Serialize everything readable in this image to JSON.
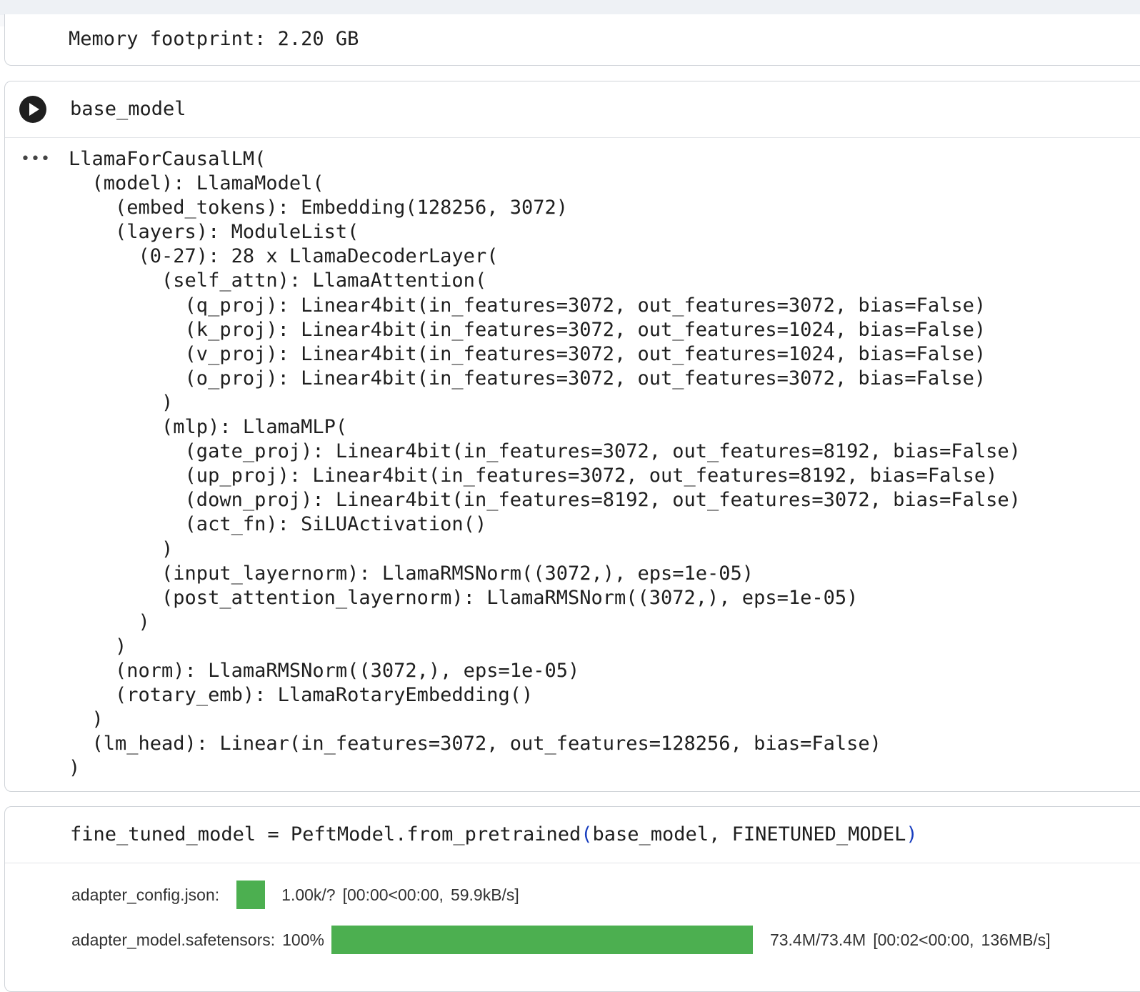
{
  "prev_cell": {
    "output_text": "Memory footprint: 2.20 GB"
  },
  "cell_model": {
    "code": "base_model",
    "output_menu": "•••",
    "output_lines": [
      "LlamaForCausalLM(",
      "  (model): LlamaModel(",
      "    (embed_tokens): Embedding(128256, 3072)",
      "    (layers): ModuleList(",
      "      (0-27): 28 x LlamaDecoderLayer(",
      "        (self_attn): LlamaAttention(",
      "          (q_proj): Linear4bit(in_features=3072, out_features=3072, bias=False)",
      "          (k_proj): Linear4bit(in_features=3072, out_features=1024, bias=False)",
      "          (v_proj): Linear4bit(in_features=3072, out_features=1024, bias=False)",
      "          (o_proj): Linear4bit(in_features=3072, out_features=3072, bias=False)",
      "        )",
      "        (mlp): LlamaMLP(",
      "          (gate_proj): Linear4bit(in_features=3072, out_features=8192, bias=False)",
      "          (up_proj): Linear4bit(in_features=3072, out_features=8192, bias=False)",
      "          (down_proj): Linear4bit(in_features=8192, out_features=3072, bias=False)",
      "          (act_fn): SiLUActivation()",
      "        )",
      "        (input_layernorm): LlamaRMSNorm((3072,), eps=1e-05)",
      "        (post_attention_layernorm): LlamaRMSNorm((3072,), eps=1e-05)",
      "      )",
      "    )",
      "    (norm): LlamaRMSNorm((3072,), eps=1e-05)",
      "    (rotary_emb): LlamaRotaryEmbedding()",
      "  )",
      "  (lm_head): Linear(in_features=3072, out_features=128256, bias=False)",
      ")"
    ]
  },
  "cell_peft": {
    "code_prefix": "fine_tuned_model = PeftModel.from_pretrained",
    "code_paren_open": "(",
    "code_args": "base_model, FINETUNED_MODEL",
    "code_paren_close": ")",
    "downloads": [
      {
        "label": "adapter_config.json:",
        "percent": "",
        "progress": 1.0,
        "bar": "small",
        "size": "1.00k/?",
        "time": "[00:00<00:00,",
        "rate": "59.9kB/s]"
      },
      {
        "label": "adapter_model.safetensors:",
        "percent": "100%",
        "progress": 1.0,
        "bar": "large",
        "size": "73.4M/73.4M",
        "time": "[00:02<00:00,",
        "rate": "136MB/s]"
      }
    ]
  },
  "colors": {
    "progress_fill": "#4caf50",
    "paren": "#1a3fbf"
  }
}
